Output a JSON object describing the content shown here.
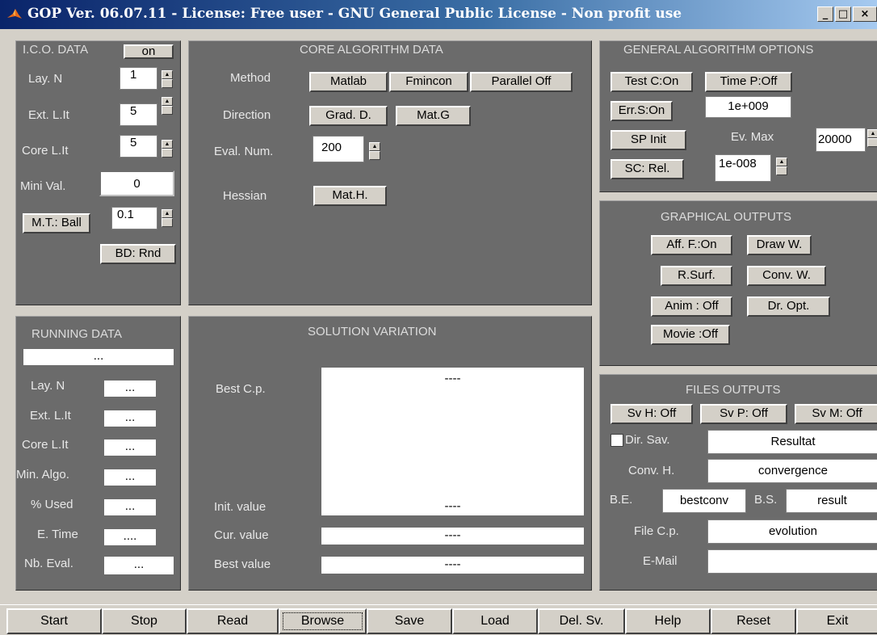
{
  "window": {
    "title": "GOP Ver. 06.07.11 - License: Free user - GNU General Public License - Non profit use",
    "logo_icon": "matlab-logo-icon",
    "controls": {
      "minimize": "_",
      "maximize": "□",
      "close": "×"
    }
  },
  "ico": {
    "title": "I.C.O. DATA",
    "toggle": "on",
    "rows": [
      {
        "label": "Lay. N",
        "value": "1"
      },
      {
        "label": "Ext. L.It",
        "value": "5"
      },
      {
        "label": "Core L.It",
        "value": "5"
      }
    ],
    "mini_val_label": "Mini Val.",
    "mini_val": "0",
    "mt_button": "M.T.: Ball",
    "mt_value": "0.1",
    "bd_button": "BD: Rnd"
  },
  "core": {
    "title": "CORE ALGORITHM DATA",
    "method_label": "Method",
    "method_buttons": [
      "Matlab",
      "Fmincon",
      "Parallel Off"
    ],
    "direction_label": "Direction",
    "direction_buttons": [
      "Grad. D.",
      "Mat.G"
    ],
    "eval_label": "Eval. Num.",
    "eval_value": "200",
    "hessian_label": "Hessian",
    "hessian_button": "Mat.H."
  },
  "general": {
    "title": "GENERAL ALGORITHM OPTIONS",
    "test_button": "Test C:On",
    "time_button": "Time P:Off",
    "err_button": "Err.S:On",
    "err_value": "1e+009",
    "sp_button": "SP Init",
    "ev_max_label": "Ev. Max",
    "ev_max_value": "20000",
    "sc_button": "SC: Rel.",
    "sc_value": "1e-008"
  },
  "graphical": {
    "title": "GRAPHICAL OUTPUTS",
    "buttons": [
      "Aff. F.:On",
      "Draw W.",
      "R.Surf.",
      "Conv. W.",
      "Anim : Off",
      "Dr. Opt.",
      "Movie :Off"
    ]
  },
  "running": {
    "title": "RUNNING DATA",
    "status": "...",
    "rows": [
      {
        "label": "Lay. N",
        "value": "..."
      },
      {
        "label": "Ext. L.It",
        "value": "..."
      },
      {
        "label": "Core L.It",
        "value": "..."
      },
      {
        "label": "Min. Algo.",
        "value": "..."
      },
      {
        "label": "% Used",
        "value": "..."
      },
      {
        "label": "E. Time",
        "value": "...."
      },
      {
        "label": "Nb. Eval.",
        "value": "..."
      }
    ]
  },
  "solution": {
    "title": "SOLUTION VARIATION",
    "best_cp_label": "Best C.p.",
    "best_cp_value": "----",
    "init_label": "Init. value",
    "init_value": "----",
    "cur_label": "Cur. value",
    "cur_value": "----",
    "best_label": "Best value",
    "best_value": "----"
  },
  "files": {
    "title": "FILES OUTPUTS",
    "sv_buttons": [
      "Sv H: Off",
      "Sv P: Off",
      "Sv M: Off"
    ],
    "dir_label": "Dir. Sav.",
    "dir_value": "Resultat",
    "conv_label": "Conv. H.",
    "conv_value": "convergence",
    "be_label": "B.E.",
    "be_value": "bestconv",
    "bs_label": "B.S.",
    "bs_value": "result",
    "file_label": "File C.p.",
    "file_value": "evolution",
    "email_label": "E-Mail",
    "email_value": ""
  },
  "bottom": {
    "buttons": [
      "Start",
      "Stop",
      "Read",
      "Browse",
      "Save",
      "Load",
      "Del. Sv.",
      "Help",
      "Reset",
      "Exit"
    ]
  }
}
